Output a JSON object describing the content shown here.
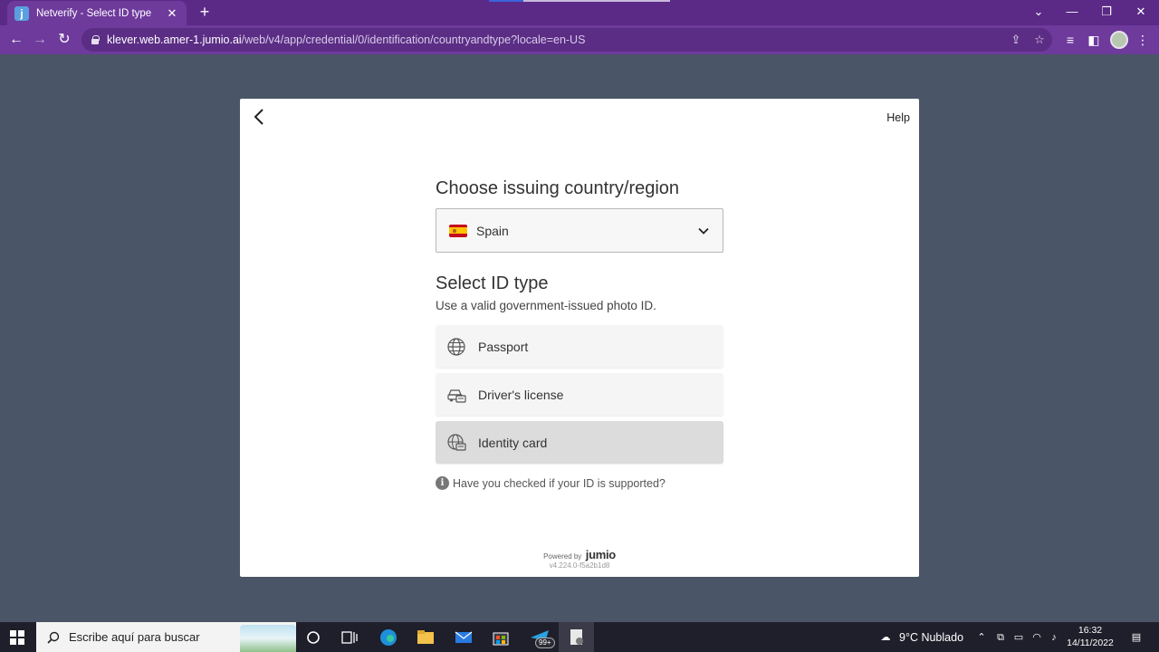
{
  "browser": {
    "tab_title": "Netverify - Select ID type",
    "tab_favicon": "j",
    "url_host": "klever.web.amer-1.jumio.ai",
    "url_path": "/web/v4/app/credential/0/identification/countryandtype?locale=en-US"
  },
  "card": {
    "help_label": "Help",
    "country_heading": "Choose issuing country/region",
    "country_value": "Spain",
    "id_heading": "Select ID type",
    "id_subtitle": "Use a valid government-issued photo ID.",
    "options": [
      {
        "label": "Passport",
        "icon": "globe-icon"
      },
      {
        "label": "Driver's license",
        "icon": "car-id-icon"
      },
      {
        "label": "Identity card",
        "icon": "id-card-icon",
        "selected": true
      }
    ],
    "info_text": "Have you checked if your ID is supported?",
    "powered_by": "Powered by",
    "brand": "jumio",
    "version": "v4.224.0-f5a2b1d8"
  },
  "taskbar": {
    "search_placeholder": "Escribe aquí para buscar",
    "badge": "99+",
    "weather": "9°C  Nublado",
    "time": "16:32",
    "date": "14/11/2022"
  },
  "colors": {
    "page_bg": "#4a5567",
    "browser_purple": "#6e3a9c",
    "selected_option": "#dcdcdc"
  }
}
